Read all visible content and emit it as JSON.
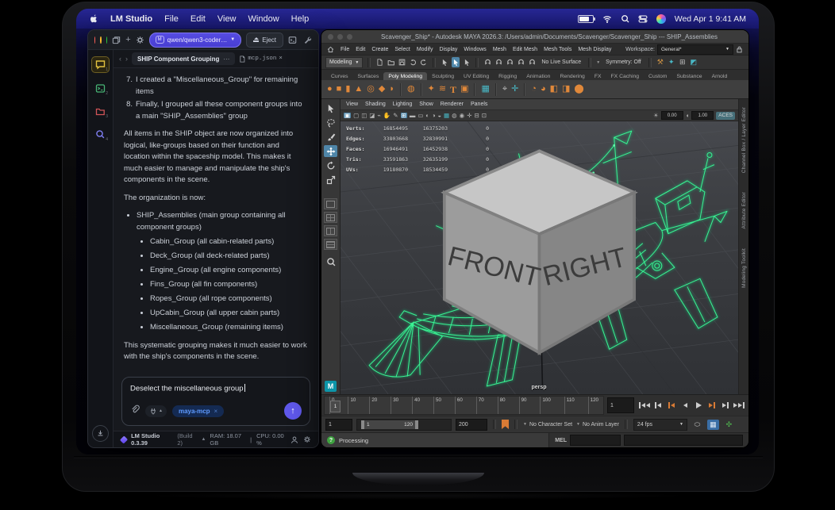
{
  "menubar": {
    "app": "LM Studio",
    "items": [
      "File",
      "Edit",
      "View",
      "Window",
      "Help"
    ],
    "clock": "Wed Apr 1  9:41 AM"
  },
  "lm": {
    "model": "qwen/qwen3-coder…",
    "model_badge": "M",
    "eject": "Eject",
    "tab_active": "SHIP Component Grouping",
    "tab_menu": "⋯",
    "tab_file": "mcp.json",
    "rail_keys": [
      "1",
      "2",
      "3",
      "4"
    ],
    "chat": {
      "item7_num": "7.",
      "item7": "I created a \"Miscellaneous_Group\" for remaining items",
      "item8_num": "8.",
      "item8": "Finally, I grouped all these component groups into a main \"SHIP_Assemblies\" group",
      "para1": "All items in the SHIP object are now organized into logical, like-groups based on their function and location within the spaceship model. This makes it much easier to manage and manipulate the ship's components in the scene.",
      "para2": "The organization is now:",
      "group_main": "SHIP_Assemblies (main group containing all component groups)",
      "groups": [
        "Cabin_Group (all cabin-related parts)",
        "Deck_Group (all deck-related parts)",
        "Engine_Group (all engine components)",
        "Fins_Group (all fin components)",
        "Ropes_Group (all rope components)",
        "UpCabin_Group (all upper cabin parts)",
        "Miscellaneous_Group (remaining items)"
      ],
      "para3": "This systematic grouping makes it much easier to work with the ship's components in the scene."
    },
    "input": {
      "value": "Deselect the miscellaneous group",
      "badge": "maya-mcp",
      "badge_close": "×"
    },
    "status": {
      "name": "LM Studio 0.3.39",
      "build": "(Build 2)",
      "ram": "RAM: 18.07 GB",
      "sep": "|",
      "cpu": "CPU: 0.00 %"
    }
  },
  "maya": {
    "title": "Scavenger_Ship* - Autodesk MAYA 2026.3: /Users/admin/Documents/Scavenger/Scavenger_Ship  ---  SHIP_Assemblies",
    "menus": [
      "File",
      "Edit",
      "Create",
      "Select",
      "Modify",
      "Display",
      "Windows",
      "Mesh",
      "Edit Mesh",
      "Mesh Tools",
      "Mesh Display"
    ],
    "workspace_label": "Workspace:",
    "workspace_value": "General*",
    "mode": "Modeling",
    "live_surface": "No Live Surface",
    "symmetry": "Symmetry: Off",
    "shelf_tabs": [
      "Curves",
      "Surfaces",
      "Poly Modeling",
      "Sculpting",
      "UV Editing",
      "Rigging",
      "Animation",
      "Rendering",
      "FX",
      "FX Caching",
      "Custom",
      "Substance",
      "Arnold"
    ],
    "panel_menus": [
      "View",
      "Shading",
      "Lighting",
      "Show",
      "Renderer",
      "Panels"
    ],
    "exposure": "0.00",
    "gamma": "1.00",
    "aces": "ACES",
    "hud": [
      {
        "label": "Verts:",
        "a": "16854495",
        "b": "16375203",
        "c": "0"
      },
      {
        "label": "Edges:",
        "a": "33803668",
        "b": "32830991",
        "c": "0"
      },
      {
        "label": "Faces:",
        "a": "16946491",
        "b": "16452938",
        "c": "0"
      },
      {
        "label": "Tris:",
        "a": "33591863",
        "b": "32635199",
        "c": "0"
      },
      {
        "label": "UVs:",
        "a": "19180870",
        "b": "18534459",
        "c": "0"
      }
    ],
    "cube_front": "FRONT",
    "cube_right": "RIGHT",
    "persp": "persp",
    "side_tabs": [
      "Channel Box / Layer Editor",
      "Attribute Editor",
      "Modeling Toolkit"
    ],
    "ticks": [
      "0",
      "10",
      "20",
      "30",
      "40",
      "50",
      "60",
      "70",
      "80",
      "90",
      "100",
      "110",
      "120"
    ],
    "current_frame": "1",
    "frame_field": "1",
    "range": {
      "start": "1",
      "min": "1",
      "max": "120",
      "end": "200",
      "charset": "No Character Set",
      "anim": "No Anim Layer",
      "fps": "24 fps"
    },
    "mel": "MEL",
    "help": "Processing"
  }
}
